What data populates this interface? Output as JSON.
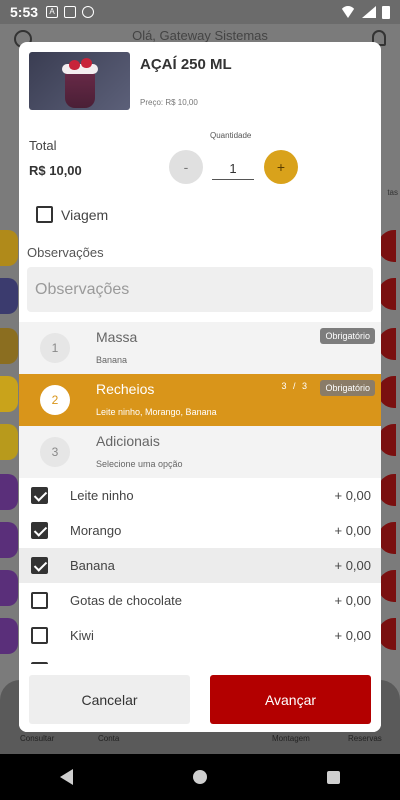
{
  "status_bar": {
    "time": "5:53"
  },
  "background": {
    "header_text": "Olá, Gateway Sistemas",
    "nav": [
      "Consultar",
      "Conta",
      "Montagem",
      "Reservas"
    ],
    "side_label": "tas"
  },
  "product": {
    "name": "AÇAÍ 250 ML",
    "price_label": "Preço:",
    "price_value": "R$ 10,00"
  },
  "total": {
    "label": "Total",
    "value": "R$ 10,00"
  },
  "quantity": {
    "label": "Quantidade",
    "value": "1",
    "minus": "-",
    "plus": "+"
  },
  "viagem": {
    "label": "Viagem",
    "checked": false
  },
  "observations": {
    "title": "Observações",
    "placeholder": "Observações"
  },
  "steps": [
    {
      "number": "1",
      "title": "Massa",
      "subtitle": "Banana",
      "badge": "Obrigatório",
      "count": ""
    },
    {
      "number": "2",
      "title": "Recheios",
      "subtitle": "Leite ninho, Morango, Banana",
      "badge": "Obrigatório",
      "count": "3 / 3"
    },
    {
      "number": "3",
      "title": "Adicionais",
      "subtitle": "Selecione uma opção",
      "badge": "",
      "count": ""
    }
  ],
  "options": [
    {
      "label": "Leite ninho",
      "price": "+ 0,00",
      "checked": true
    },
    {
      "label": "Morango",
      "price": "+ 0,00",
      "checked": true
    },
    {
      "label": "Banana",
      "price": "+ 0,00",
      "checked": true
    },
    {
      "label": "Gotas de chocolate",
      "price": "+ 0,00",
      "checked": false
    },
    {
      "label": "Kiwi",
      "price": "+ 0,00",
      "checked": false
    }
  ],
  "footer": {
    "cancel_label": "Cancelar",
    "next_label": "Avançar"
  },
  "colors": {
    "accent": "#d9951a",
    "primary": "#b30000",
    "badge": "#7d7d7d"
  }
}
